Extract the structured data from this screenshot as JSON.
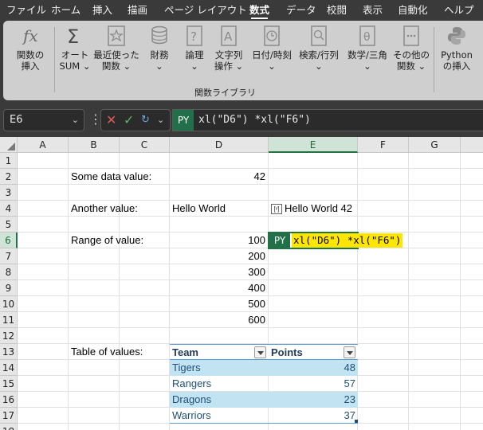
{
  "menu": {
    "tabs": [
      "ファイル",
      "ホーム",
      "挿入",
      "描画",
      "ページ レイアウト",
      "数式",
      "データ",
      "校閲",
      "表示",
      "自動化",
      "ヘルプ"
    ],
    "active_tab": "数式"
  },
  "ribbon": {
    "insert_function": [
      "関数の",
      "挿入"
    ],
    "autosum": [
      "オート",
      "SUM ⌄"
    ],
    "recent": [
      "最近使った",
      "関数 ⌄"
    ],
    "financial": [
      "財務",
      "⌄"
    ],
    "logical": [
      "論理",
      "⌄"
    ],
    "text": [
      "文字列",
      "操作 ⌄"
    ],
    "datetime": [
      "日付/時刻",
      "⌄"
    ],
    "lookup": [
      "検索/行列",
      "⌄"
    ],
    "math": [
      "数学/三角",
      "⌄"
    ],
    "more": [
      "その他の",
      "関数 ⌄"
    ],
    "group_label": "関数ライブラリ",
    "python_insert": [
      "Python",
      "の挿入"
    ]
  },
  "formula_bar": {
    "name_box": "E6",
    "py_badge": "PY",
    "formula": "xl(\"D6\") *xl(\"F6\")"
  },
  "columns": [
    "A",
    "B",
    "C",
    "D",
    "E",
    "F",
    "G"
  ],
  "selected_column": "E",
  "rows": [
    "1",
    "2",
    "3",
    "4",
    "5",
    "6",
    "7",
    "8",
    "9",
    "10",
    "11",
    "12",
    "13",
    "14",
    "15",
    "16",
    "17",
    "18"
  ],
  "selected_row": "6",
  "cells": {
    "b2": "Some data value:",
    "d2": "42",
    "b4": "Another value:",
    "d4": "Hello World",
    "e4_icon": "[ʸ]",
    "e4": "Hello World 42",
    "b6": "Range of value:",
    "d6": "100",
    "d7": "200",
    "d8": "300",
    "d9": "400",
    "d10": "500",
    "d11": "600",
    "b13": "Table of values:"
  },
  "selected_cell": {
    "py_badge": "PY",
    "text": "xl(\"D6\") *xl(\"F6\")"
  },
  "table": {
    "headers": [
      "Team",
      "Points"
    ],
    "rows": [
      {
        "team": "Tigers",
        "points": "48"
      },
      {
        "team": "Rangers",
        "points": "57"
      },
      {
        "team": "Dragons",
        "points": "23"
      },
      {
        "team": "Warriors",
        "points": "37"
      }
    ]
  },
  "colors": {
    "accent_green": "#217346",
    "python_badge": "#21704a",
    "highlight_yellow": "#ffe600",
    "table_band": "#c2e3f2"
  }
}
